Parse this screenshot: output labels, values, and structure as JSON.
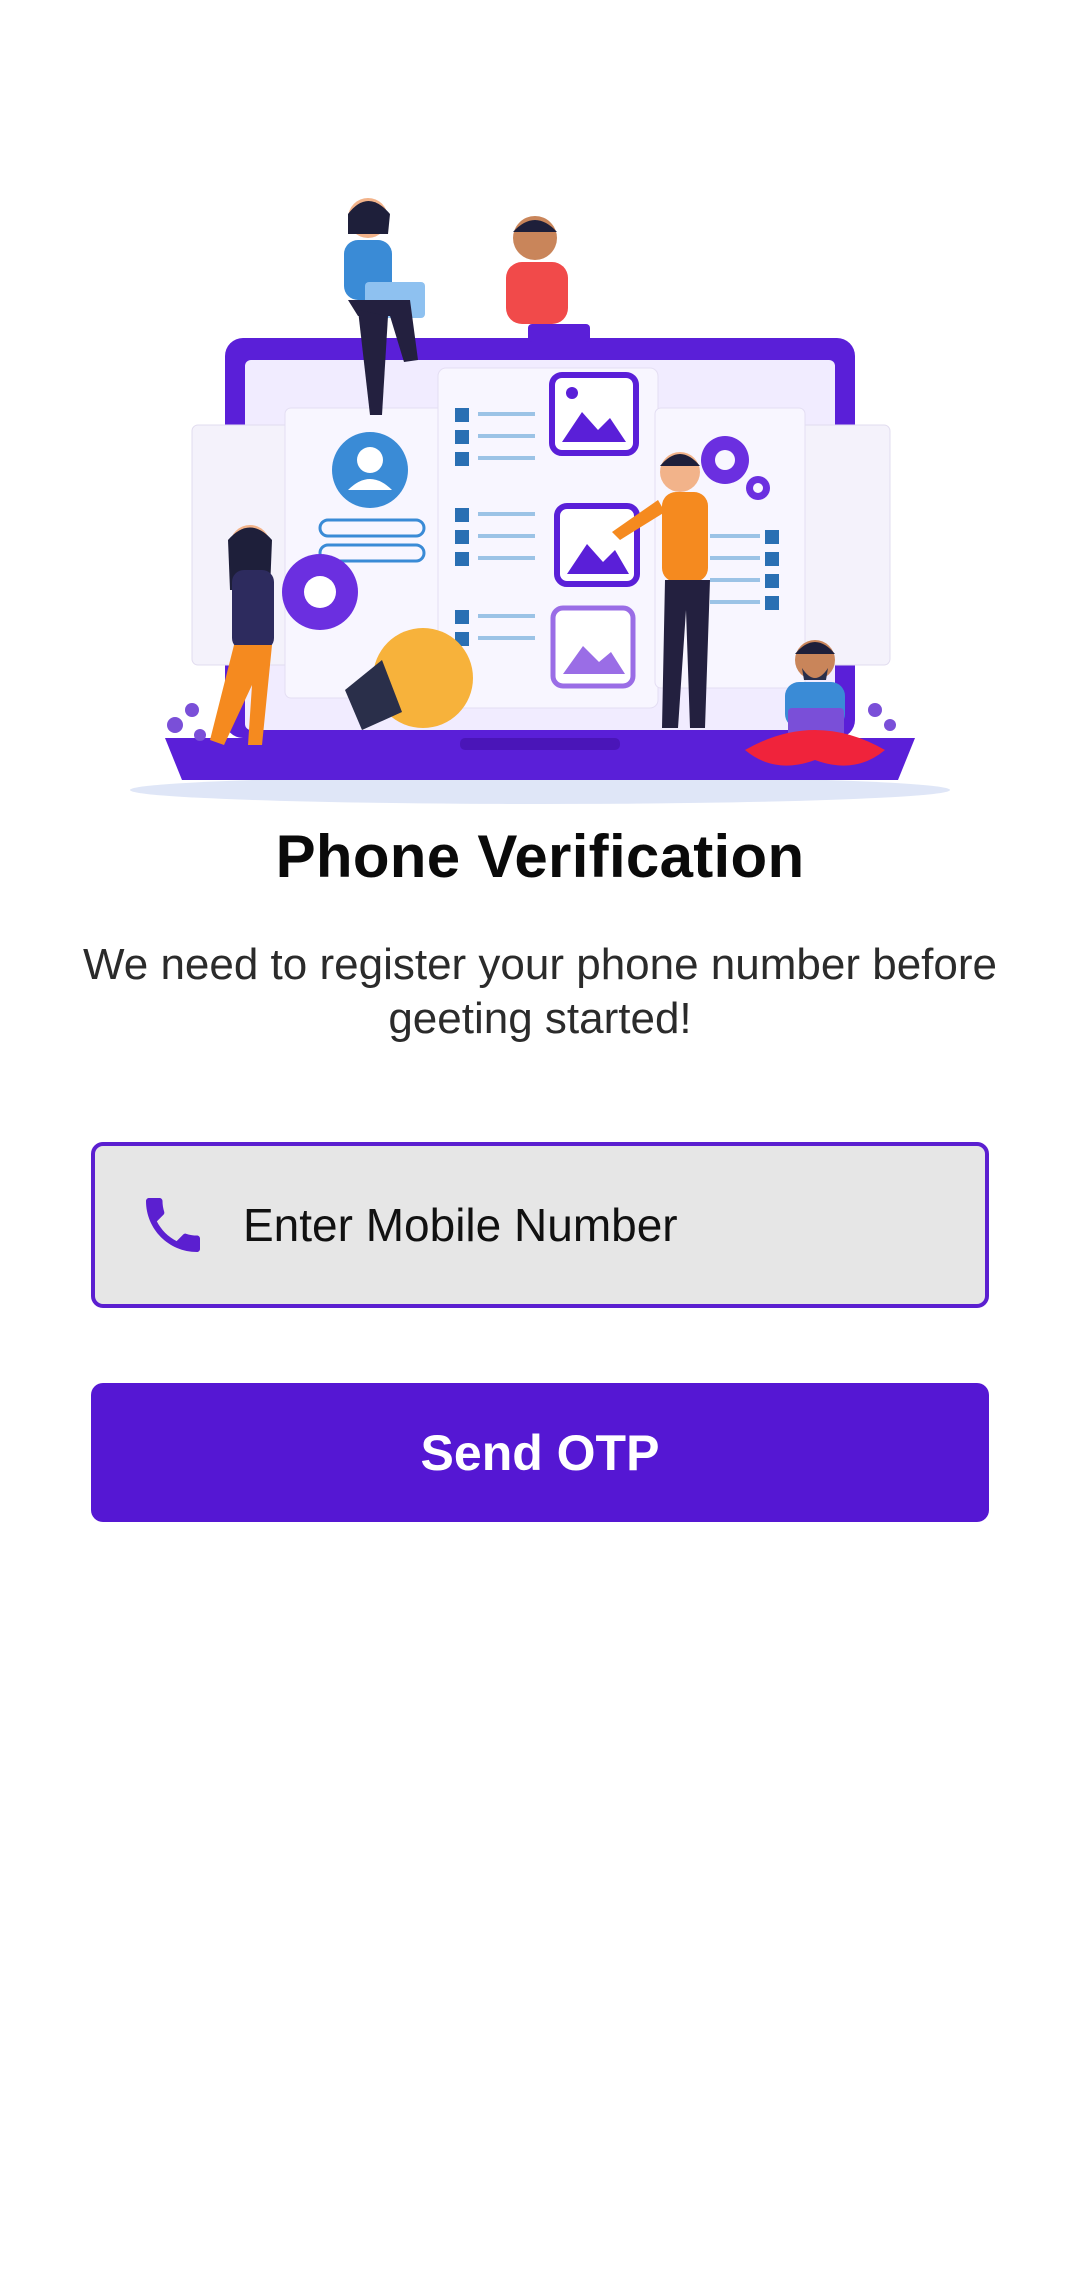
{
  "screen": {
    "title": "Phone Verification",
    "subtitle": "We need to register your phone number before geeting started!"
  },
  "phone_field": {
    "icon": "phone-icon",
    "placeholder": "Enter Mobile Number",
    "value": ""
  },
  "actions": {
    "send_otp_label": "Send OTP"
  },
  "colors": {
    "accent": "#5517d3",
    "field_border": "#5b1fd0",
    "field_background": "#e6e6e6",
    "background": "#ffffff"
  }
}
